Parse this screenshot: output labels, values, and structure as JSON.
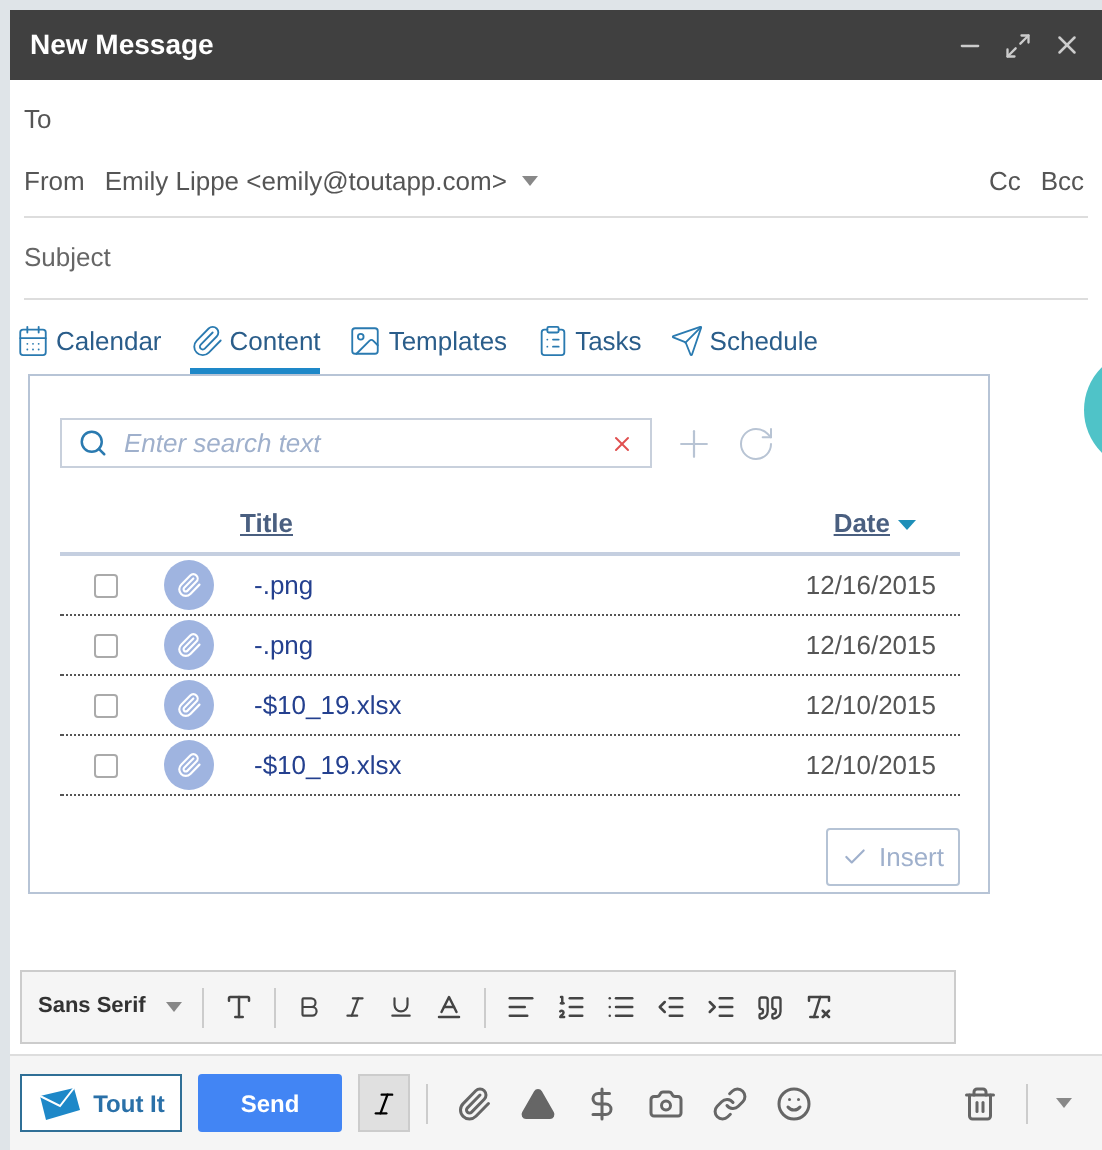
{
  "window": {
    "title": "New Message"
  },
  "to": {
    "label": "To"
  },
  "from": {
    "label": "From",
    "value": "Emily Lippe <emily@toutapp.com>",
    "cc": "Cc",
    "bcc": "Bcc"
  },
  "subject": {
    "placeholder": "Subject"
  },
  "tabs": [
    {
      "label": "Calendar",
      "selected": false
    },
    {
      "label": "Content",
      "selected": true
    },
    {
      "label": "Templates",
      "selected": false
    },
    {
      "label": "Tasks",
      "selected": false
    },
    {
      "label": "Schedule",
      "selected": false
    }
  ],
  "search": {
    "placeholder": "Enter search text"
  },
  "table": {
    "columns": [
      {
        "label": "Title",
        "sorted": false
      },
      {
        "label": "Date",
        "sorted": true
      }
    ],
    "rows": [
      {
        "title": "-.png",
        "date": "12/16/2015",
        "checked": false
      },
      {
        "title": "-.png",
        "date": "12/16/2015",
        "checked": false
      },
      {
        "title": "-$10_19.xlsx",
        "date": "12/10/2015",
        "checked": false
      },
      {
        "title": "-$10_19.xlsx",
        "date": "12/10/2015",
        "checked": false
      }
    ]
  },
  "insert_button": {
    "label": "Insert",
    "disabled": true
  },
  "format_toolbar": {
    "font": "Sans Serif"
  },
  "bottom_bar": {
    "tout_button": "Tout It",
    "send_button": "Send"
  }
}
